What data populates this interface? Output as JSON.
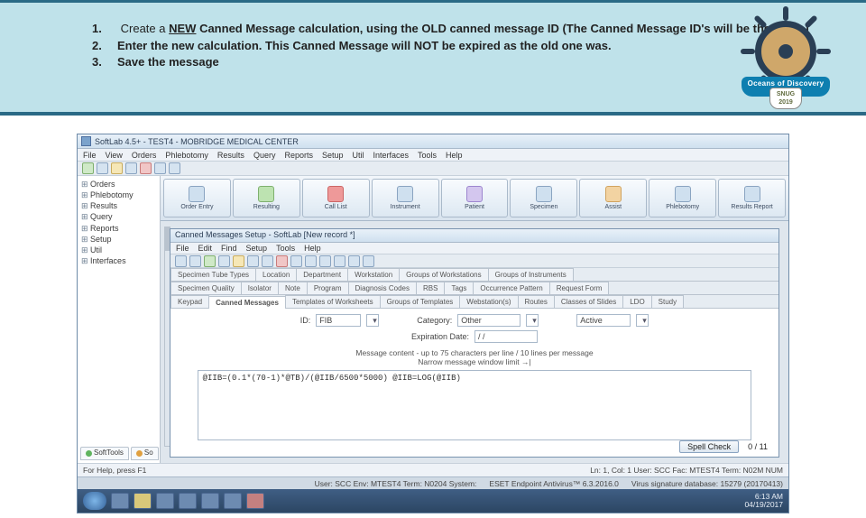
{
  "instructions": {
    "i1_pre": "Create a ",
    "i1_boldu": "NEW",
    "i1_mid": " Canned Message calculation, using the ",
    "i1_boldb": "OLD",
    "i1_post": " canned message ID (The Canned Message ID's will be the Same)",
    "i2": "Enter the new calculation.  This Canned Message will NOT be expired as the old one was.",
    "i3": "Save the message"
  },
  "logo": {
    "banner": "Oceans of Discovery",
    "shield_top": "SNUG",
    "shield_year": "2019"
  },
  "app": {
    "title": "SoftLab 4.5+ - TEST4 - MOBRIDGE MEDICAL CENTER",
    "menus": [
      "File",
      "View",
      "Orders",
      "Phlebotomy",
      "Results",
      "Query",
      "Reports",
      "Setup",
      "Util",
      "Interfaces",
      "Tools",
      "Help"
    ],
    "tree": [
      "Orders",
      "Phlebotomy",
      "Results",
      "Query",
      "Reports",
      "Setup",
      "Util",
      "Interfaces"
    ],
    "bigButtons": [
      "Order Entry",
      "Resulting",
      "Call List",
      "Instrument",
      "Patient",
      "Specimen",
      "Assist",
      "Phlebotomy",
      "Results Report"
    ]
  },
  "subwin": {
    "title": "Canned Messages Setup - SoftLab   [New record *]",
    "menus": [
      "File",
      "Edit",
      "Find",
      "Setup",
      "Tools",
      "Help"
    ],
    "tabs_row1": [
      "Specimen Tube Types",
      "Location",
      "Department",
      "Workstation",
      "Groups of Workstations",
      "Groups of Instruments"
    ],
    "tabs_row2": [
      "Specimen Quality",
      "Isolator",
      "Note",
      "Program",
      "Diagnosis Codes",
      "RBS",
      "Tags",
      "Occurrence Pattern",
      "Request Form"
    ],
    "tabs_row3": [
      "Keypad",
      "Canned Messages",
      "Templates of Worksheets",
      "Groups of Templates",
      "Webstation(s)",
      "Routes",
      "Classes of Slides",
      "LDO",
      "Study"
    ],
    "id_label": "ID:",
    "id_value": "FIB",
    "cat_label": "Category:",
    "cat_value": "Other",
    "active_value": "Active",
    "exp_label": "Expiration Date:",
    "exp_value": "/ /",
    "content_label": "Message content - up to 75 characters per line / 10 lines per message",
    "fit_label": "Narrow message window limit →|",
    "formula": "@IIB=(0.1*(70-1)*@TB)/(@IIB/6500*5000)   @IIB=LOG(@IIB)",
    "spell": "Spell Check",
    "count": "0 / 11"
  },
  "footer1": {
    "help": "For Help, press F1",
    "status": "Ln: 1, Col: 1   User: SCC   Fac: MTEST4   Term: N02M      NUM"
  },
  "footer2": {
    "a": "User: SCC  Env: MTEST4   Term: N0204  System:",
    "b": "ESET Endpoint Antivirus™ 6.3.2016.0",
    "c": "Virus signature database: 15279 (20170413)"
  },
  "taskbar": {
    "time": "6:13 AM",
    "date": "04/19/2017"
  },
  "sidetabs": {
    "a": "SoftTools",
    "b": "So"
  }
}
